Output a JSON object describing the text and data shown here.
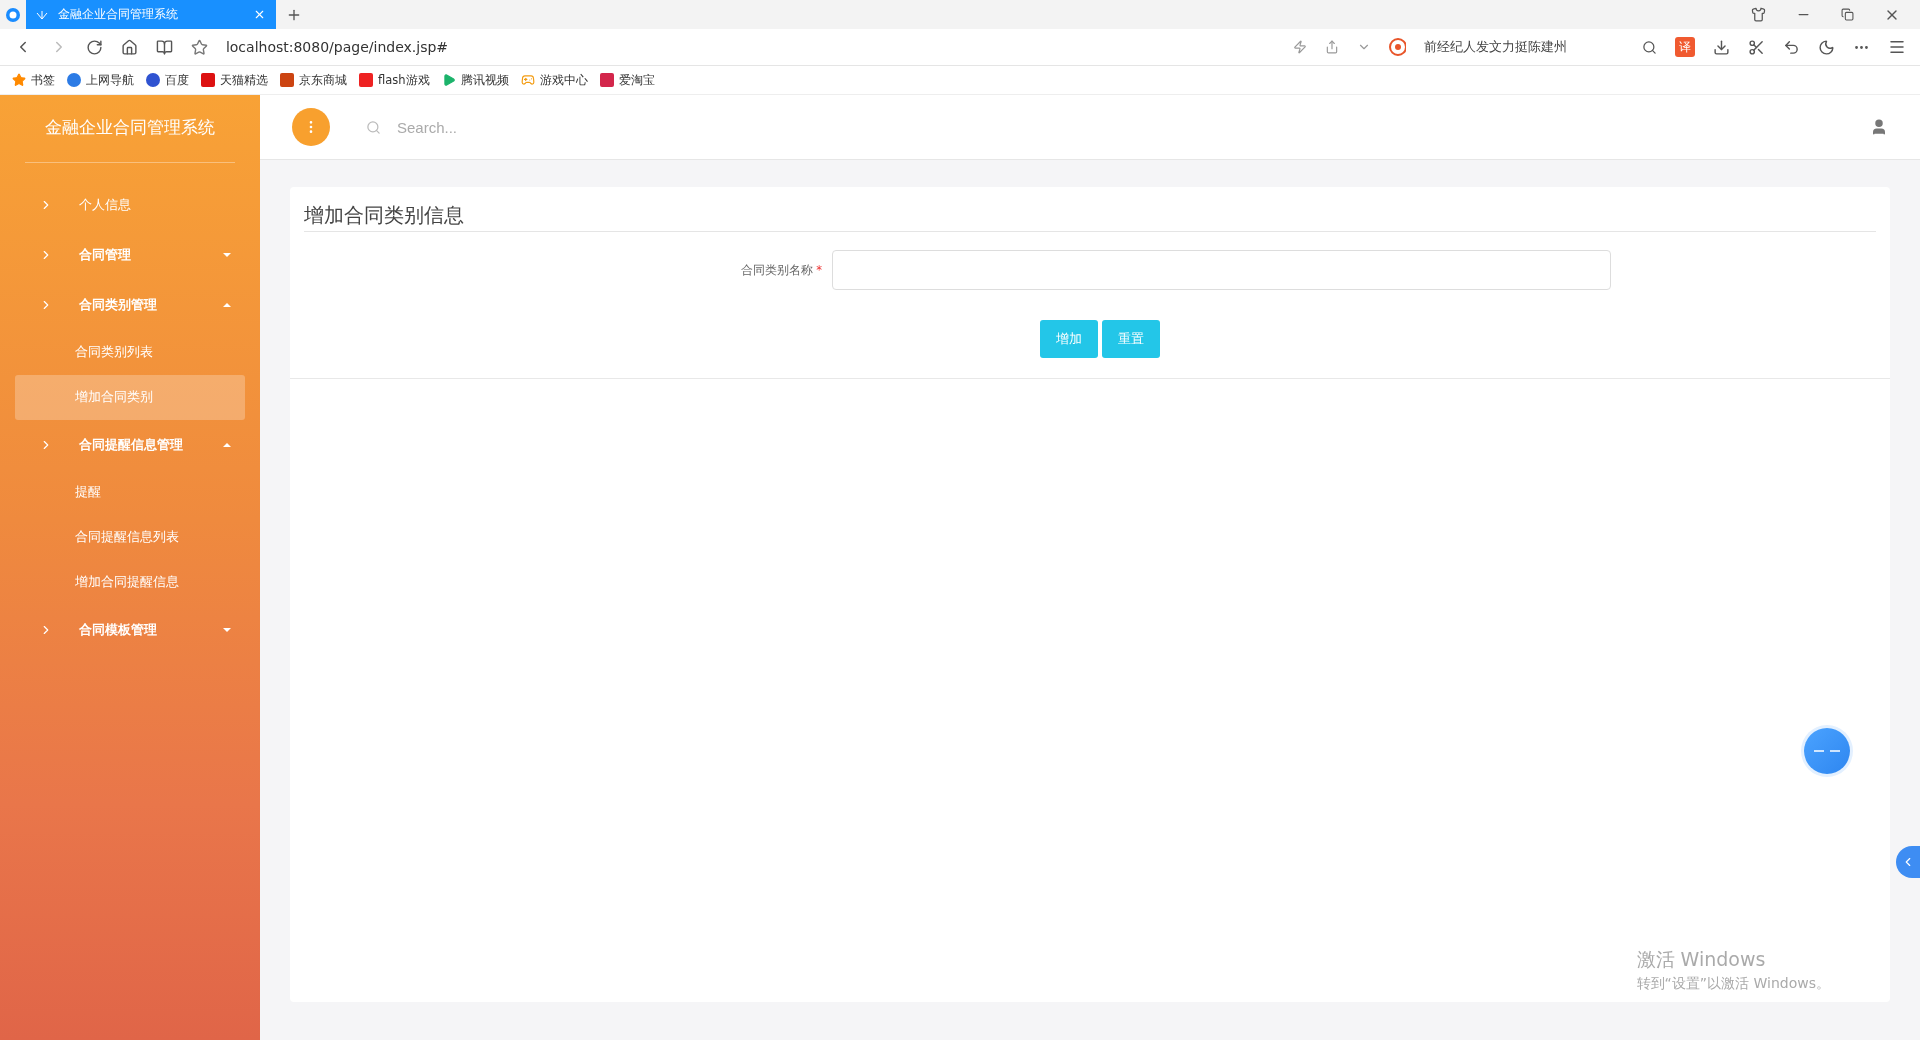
{
  "browser": {
    "tab": {
      "title": "金融企业合同管理系统",
      "selected": true
    },
    "address": "localhost:8080/page/index.jsp#",
    "search_text": "前经纪人发文力挺陈建州",
    "translate_label": "译",
    "bookmarks": [
      {
        "label": "书签",
        "kind": "star"
      },
      {
        "label": "上网导航",
        "kind": "ie"
      },
      {
        "label": "百度",
        "kind": "paw"
      },
      {
        "label": "天猫精选",
        "kind": "tmall"
      },
      {
        "label": "京东商城",
        "kind": "jd"
      },
      {
        "label": "flash游戏",
        "kind": "flash"
      },
      {
        "label": "腾讯视频",
        "kind": "play"
      },
      {
        "label": "游戏中心",
        "kind": "game"
      },
      {
        "label": "爱淘宝",
        "kind": "taobao"
      }
    ]
  },
  "sidebar": {
    "title": "金融企业合同管理系统",
    "items": [
      {
        "label": "个人信息",
        "kind": "link",
        "selected": false
      },
      {
        "label": "合同管理",
        "kind": "group",
        "expanded": false
      },
      {
        "label": "合同类别管理",
        "kind": "group",
        "expanded": true,
        "children": [
          {
            "label": "合同类别列表",
            "selected": false
          },
          {
            "label": "增加合同类别",
            "selected": true
          }
        ]
      },
      {
        "label": "合同提醒信息管理",
        "kind": "group",
        "expanded": true,
        "children": [
          {
            "label": "提醒",
            "selected": false
          },
          {
            "label": "合同提醒信息列表",
            "selected": false
          },
          {
            "label": "增加合同提醒信息",
            "selected": false
          }
        ]
      },
      {
        "label": "合同模板管理",
        "kind": "group",
        "expanded": false
      }
    ]
  },
  "topbar": {
    "search": {
      "placeholder": "Search..."
    }
  },
  "form": {
    "title": "增加合同类别信息",
    "fields": [
      {
        "label": "合同类别名称",
        "required_mark": "*"
      }
    ],
    "buttons": [
      "增加",
      "重置"
    ]
  },
  "os_overlay": {
    "title": "激活 Windows",
    "subtitle": "转到“设置”以激活 Windows。"
  }
}
